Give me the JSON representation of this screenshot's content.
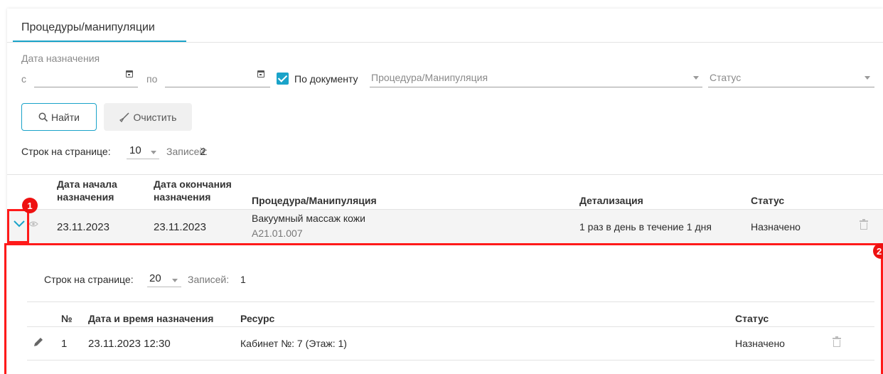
{
  "tab": {
    "label": "Процедуры/манипуляции"
  },
  "filters": {
    "date_label": "Дата назначения",
    "from_label": "с",
    "to_label": "по",
    "by_document_label": "По документу",
    "procedure_placeholder": "Процедура/Манипуляция",
    "status_placeholder": "Статус",
    "by_document_checked": true
  },
  "buttons": {
    "find": "Найти",
    "clear": "Очистить"
  },
  "pagination": {
    "rows_label": "Строк на странице:",
    "rows_value": "10",
    "records_label": "Записей:",
    "records_value": "2"
  },
  "table": {
    "headers": {
      "start_line1": "Дата начала",
      "start_line2": "назначения",
      "end_line1": "Дата окончания",
      "end_line2": "назначения",
      "procedure": "Процедура/Манипуляция",
      "detail": "Детализация",
      "status": "Статус"
    },
    "rows": [
      {
        "start": "23.11.2023",
        "end": "23.11.2023",
        "procedure_name": "Вакуумный массаж кожи",
        "procedure_code": "A21.01.007",
        "detail": "1 раз в день в течение 1 дня",
        "status": "Назначено"
      }
    ]
  },
  "subtable": {
    "pagination": {
      "rows_label": "Строк на странице:",
      "rows_value": "20",
      "records_label": "Записей:",
      "records_value": "1"
    },
    "headers": {
      "num": "№",
      "datetime": "Дата и время назначения",
      "resource": "Ресурс",
      "status": "Статус"
    },
    "rows": [
      {
        "num": "1",
        "datetime": "23.11.2023 12:30",
        "resource": "Кабинет №: 7 (Этаж: 1)",
        "status": "Назначено"
      }
    ]
  },
  "annotations": {
    "badge1": "1",
    "badge2": "2"
  },
  "colors": {
    "accent": "#1aa3c9",
    "annotation": "#ff1a1a"
  }
}
